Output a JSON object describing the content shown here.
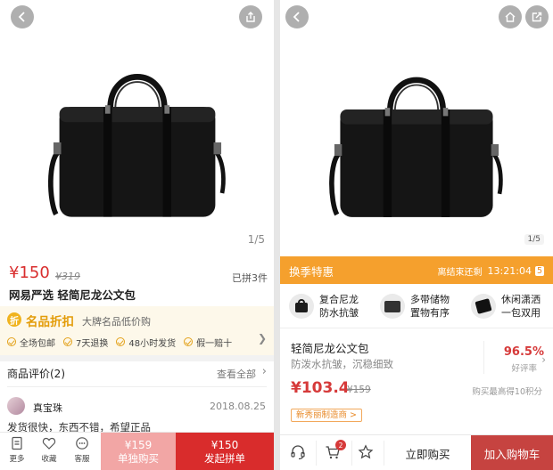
{
  "left": {
    "gallery": {
      "page_indicator": "1/5"
    },
    "price": "¥150",
    "original_price": "¥319",
    "sold_count": "已拼3件",
    "title": "网易严选 轻简尼龙公文包",
    "promo": {
      "badge": "折",
      "title": "名品折扣",
      "subtitle": "大牌名品低价购",
      "services": [
        "全场包邮",
        "7天退换",
        "48小时发货",
        "假一赔十"
      ]
    },
    "reviews": {
      "title": "商品评价(2)",
      "see_all": "查看全部",
      "items": [
        {
          "name": "真宝珠",
          "date": "2018.08.25",
          "text": "发货很快，东西不错，希望正品"
        }
      ]
    },
    "bottom_bar": {
      "more": "更多",
      "favorite": "收藏",
      "service": "客服",
      "solo_price": "¥159",
      "solo_label": "单独购买",
      "group_price": "¥150",
      "group_label": "发起拼单"
    }
  },
  "right": {
    "gallery": {
      "page_indicator": "1/5"
    },
    "sale": {
      "title": "换季特惠",
      "countdown_label": "离结束还剩",
      "countdown_time": "13:21:04",
      "countdown_box": "5"
    },
    "features": [
      {
        "line1": "复合尼龙",
        "line2": "防水抗皱"
      },
      {
        "line1": "多带储物",
        "line2": "置物有序"
      },
      {
        "line1": "休闲潇洒",
        "line2": "一包双用"
      }
    ],
    "product": {
      "name": "轻简尼龙公文包",
      "description": "防泼水抗皱，沉稳细致",
      "price": "¥103.4",
      "original_price": "¥159",
      "rating": "96.5%",
      "rating_label": "好评率",
      "points": "购买最高得10积分",
      "tag": "新秀丽制造商 >"
    },
    "bottom_bar": {
      "cart_count": "2",
      "buy_now": "立即购买",
      "add_to_cart": "加入购物车"
    }
  },
  "colors": {
    "red": "#d92c2c",
    "light_red": "#f2a6a5",
    "orange": "#f5a02d",
    "gold": "#e39c09",
    "cart_red": "#c64340"
  }
}
